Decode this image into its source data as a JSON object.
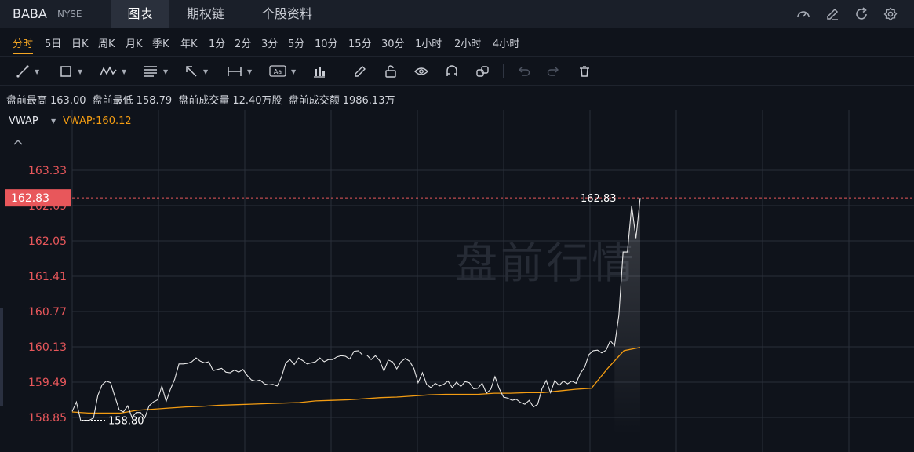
{
  "header": {
    "ticker": "BABA",
    "exchange": "NYSE",
    "tabs": [
      {
        "label": "图表",
        "active": true
      },
      {
        "label": "期权链",
        "active": false
      },
      {
        "label": "个股资料",
        "active": false
      }
    ],
    "icons": [
      "speedometer-icon",
      "edit-icon",
      "refresh-icon",
      "settings-icon"
    ]
  },
  "periods": [
    {
      "label": "分时",
      "active": true
    },
    {
      "label": "5日"
    },
    {
      "label": "日K"
    },
    {
      "label": "周K"
    },
    {
      "label": "月K"
    },
    {
      "label": "季K"
    },
    {
      "label": "年K"
    },
    {
      "label": "1分"
    },
    {
      "label": "2分"
    },
    {
      "label": "3分"
    },
    {
      "label": "5分"
    },
    {
      "label": "10分"
    },
    {
      "label": "15分"
    },
    {
      "label": "30分"
    },
    {
      "label": "1小时"
    },
    {
      "label": "2小时"
    },
    {
      "label": "4小时"
    }
  ],
  "toolbar_icons": [
    "line-tool-icon",
    "rectangle-tool-icon",
    "pattern-tool-icon",
    "fibonacci-tool-icon",
    "arrow-tool-icon",
    "measure-tool-icon",
    "text-tool-icon",
    "indicator-icon",
    "pencil-icon",
    "unlock-icon",
    "eye-icon",
    "magnet-icon",
    "link-icon",
    "undo-icon",
    "redo-icon",
    "delete-icon"
  ],
  "stats": {
    "high_label": "盘前最高",
    "high_value": "163.00",
    "low_label": "盘前最低",
    "low_value": "158.79",
    "volume_label": "盘前成交量",
    "volume_value": "12.40万股",
    "turnover_label": "盘前成交额",
    "turnover_value": "1986.13万"
  },
  "indicator": {
    "name": "VWAP",
    "value_text": "VWAP:160.12"
  },
  "colors": {
    "price_line": "#e8e8e8",
    "vwap_line": "#f39c12",
    "last_price_badge": "#e8575b",
    "axis_label": "#e8575b",
    "background": "#0f131b"
  },
  "chart_data": {
    "type": "line",
    "watermark": "盘前行情",
    "y_ticks": [
      "163.33",
      "162.69",
      "162.05",
      "161.41",
      "160.77",
      "160.13",
      "159.49",
      "158.85"
    ],
    "ylim": [
      158.54,
      163.63
    ],
    "last_price": "162.83",
    "last_price_label": "162.83",
    "low_marker_label": "158.80",
    "grid": true,
    "series": [
      {
        "id": "price",
        "values": [
          158.96,
          159.13,
          158.79,
          158.8,
          158.8,
          158.84,
          159.25,
          159.44,
          159.51,
          159.48,
          159.23,
          158.99,
          158.95,
          159.06,
          158.85,
          158.94,
          158.94,
          158.84,
          159.06,
          159.13,
          159.17,
          159.42,
          159.14,
          159.36,
          159.54,
          159.82,
          159.82,
          159.83,
          159.86,
          159.93,
          159.87,
          159.84,
          159.86,
          159.7,
          159.72,
          159.74,
          159.67,
          159.66,
          159.71,
          159.67,
          159.72,
          159.61,
          159.53,
          159.51,
          159.53,
          159.46,
          159.44,
          159.45,
          159.42,
          159.58,
          159.84,
          159.9,
          159.81,
          159.93,
          159.88,
          159.82,
          159.84,
          159.86,
          159.93,
          159.86,
          159.9,
          159.9,
          159.95,
          159.97,
          159.96,
          159.91,
          160.05,
          160.06,
          159.98,
          159.98,
          159.9,
          159.97,
          159.88,
          159.69,
          159.89,
          159.86,
          159.73,
          159.86,
          159.92,
          159.87,
          159.74,
          159.48,
          159.66,
          159.45,
          159.39,
          159.47,
          159.42,
          159.45,
          159.51,
          159.39,
          159.49,
          159.41,
          159.5,
          159.48,
          159.37,
          159.38,
          159.47,
          159.29,
          159.36,
          159.59,
          159.37,
          159.22,
          159.2,
          159.16,
          159.18,
          159.12,
          159.09,
          159.16,
          159.04,
          159.09,
          159.37,
          159.52,
          159.3,
          159.52,
          159.43,
          159.51,
          159.46,
          159.51,
          159.47,
          159.65,
          159.76,
          159.99,
          160.06,
          160.07,
          160.02,
          160.07,
          160.24,
          160.15,
          160.7,
          161.85,
          161.85,
          162.69,
          162.1,
          162.83
        ]
      },
      {
        "id": "vwap",
        "values": [
          158.95,
          158.93,
          158.93,
          158.93,
          158.98,
          159.0,
          159.02,
          159.04,
          159.05,
          159.07,
          159.08,
          159.09,
          159.1,
          159.11,
          159.12,
          159.15,
          159.16,
          159.17,
          159.19,
          159.21,
          159.22,
          159.24,
          159.26,
          159.27,
          159.27,
          159.27,
          159.29,
          159.29,
          159.3,
          159.3,
          159.33,
          159.36,
          159.38,
          159.74,
          160.06,
          160.12
        ]
      }
    ]
  }
}
